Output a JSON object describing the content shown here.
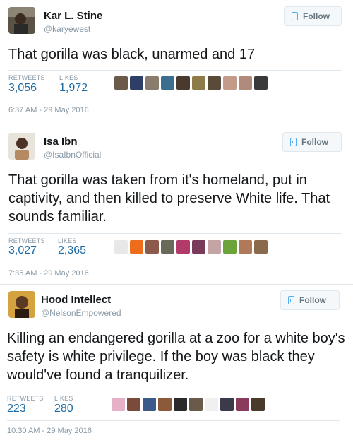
{
  "tweets": [
    {
      "name": "Kar L. Stine",
      "handle": "@karyewest",
      "follow_label": "Follow",
      "text": "That gorilla was black, unarmed and 17",
      "retweets_label": "RETWEETS",
      "retweets": "3,056",
      "likes_label": "LIKES",
      "likes": "1,972",
      "timestamp": "6:37 AM - 29 May 2016",
      "liker_colors": [
        "#6b5a4a",
        "#2d3f66",
        "#8a7d6e",
        "#3b6e8f",
        "#4a3a2e",
        "#8d7b4a",
        "#5a4a3a",
        "#c49a8a",
        "#b08a7a",
        "#3a3a3a"
      ]
    },
    {
      "name": "Isa Ibn",
      "handle": "@IsaIbnOfficial",
      "follow_label": "Follow",
      "text": "That gorilla was taken from it's homeland, put in captivity, and then killed to preserve White life. That sounds familiar.",
      "retweets_label": "RETWEETS",
      "retweets": "3,027",
      "likes_label": "LIKES",
      "likes": "2,365",
      "timestamp": "7:35 AM - 29 May 2016",
      "liker_colors": [
        "#e8e8e8",
        "#ef6c1a",
        "#8c5a4a",
        "#6a6a5a",
        "#b23a6a",
        "#7a3a5a",
        "#c4a4a4",
        "#6aa43a",
        "#b07a5a",
        "#8a6a4a"
      ]
    },
    {
      "name": "Hood Intellect",
      "handle": "@NelsonEmpowered",
      "follow_label": "Follow",
      "text": "Killing an endangered gorilla at a zoo for a white boy's safety is white privilege. If the boy was black they would've found a tranquilizer.",
      "retweets_label": "RETWEETS",
      "retweets": "223",
      "likes_label": "LIKES",
      "likes": "280",
      "timestamp": "10:30 AM - 29 May 2016",
      "liker_colors": [
        "#e6b0c6",
        "#7a4a3a",
        "#3a5a8a",
        "#8a5a3a",
        "#2a2a2a",
        "#6a5a4a",
        "#f0f0f0",
        "#3a3a4a",
        "#8a3a5a",
        "#4a3a2a"
      ]
    }
  ]
}
